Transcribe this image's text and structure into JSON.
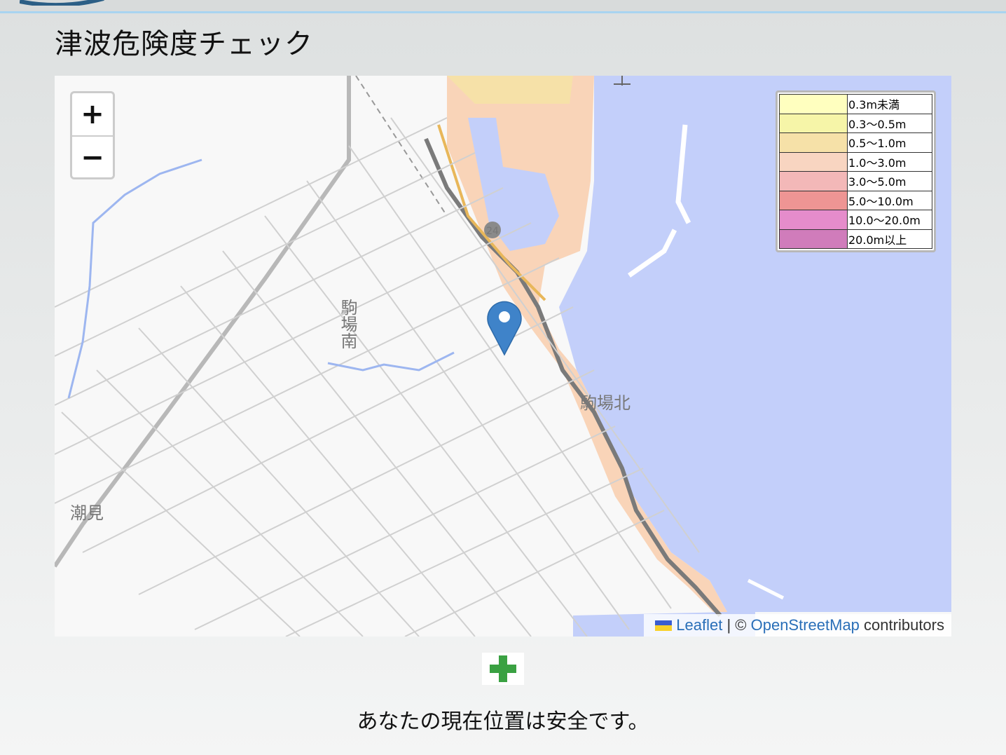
{
  "page": {
    "title": "津波危険度チェック",
    "status_message": "あなたの現在位置は安全です。"
  },
  "map": {
    "zoom_in_label": "+",
    "zoom_out_label": "−",
    "place_labels": [
      "駒場南",
      "駒場北",
      "潮見"
    ],
    "road_shield": "24",
    "attribution": {
      "leaflet": "Leaflet",
      "separator": "| ©",
      "osm": "OpenStreetMap",
      "contributors": "contributors"
    },
    "colors": {
      "sea": "#c3cffa",
      "land": "#f8f8f8",
      "inundation": "#f9d4b8",
      "marker": "#3f83c9"
    }
  },
  "legend": {
    "items": [
      {
        "label": "0.3m未満",
        "color": "#ffffbf"
      },
      {
        "label": "0.3〜0.5m",
        "color": "#f6f5a8"
      },
      {
        "label": "0.5〜1.0m",
        "color": "#f6e1a8"
      },
      {
        "label": "1.0〜3.0m",
        "color": "#f8d5c1"
      },
      {
        "label": "3.0〜5.0m",
        "color": "#f3b8b8"
      },
      {
        "label": "5.0〜10.0m",
        "color": "#ee9594"
      },
      {
        "label": "10.0〜20.0m",
        "color": "#e58ccb"
      },
      {
        "label": "20.0m以上",
        "color": "#d07cbb"
      }
    ]
  }
}
